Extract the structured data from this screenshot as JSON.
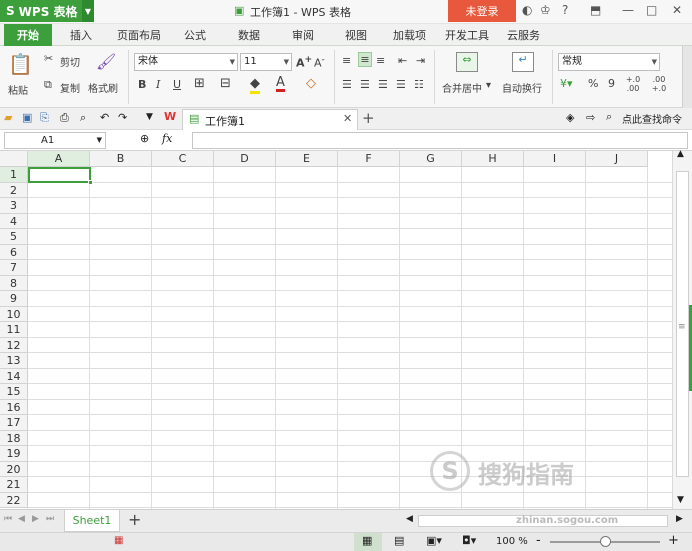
{
  "app": {
    "name": "WPS 表格",
    "doc_title": "工作簿1 - WPS 表格",
    "login": "未登录"
  },
  "menu_tabs": [
    "开始",
    "插入",
    "页面布局",
    "公式",
    "数据",
    "审阅",
    "视图",
    "加载项",
    "开发工具",
    "云服务"
  ],
  "ribbon": {
    "paste": "粘贴",
    "cut": "剪切",
    "copy": "复制",
    "format_painter": "格式刷",
    "font_name": "宋体",
    "font_size": "11",
    "bold": "B",
    "italic": "I",
    "underline": "U",
    "merge_center": "合并居中",
    "wrap_text": "自动换行",
    "number_format": "常规",
    "percent": "%",
    "thousands": "9",
    "inc_decimal": "+.0 .00",
    "dec_decimal": ".00 +.0"
  },
  "doc_tab": "工作簿1",
  "find_command": "点此查找命令",
  "name_box": "A1",
  "fx": "fx",
  "columns": [
    "A",
    "B",
    "C",
    "D",
    "E",
    "F",
    "G",
    "H",
    "I",
    "J"
  ],
  "rows": [
    "1",
    "2",
    "3",
    "4",
    "5",
    "6",
    "7",
    "8",
    "9",
    "10",
    "11",
    "12",
    "13",
    "14",
    "15",
    "16",
    "17",
    "18",
    "19",
    "20",
    "21",
    "22"
  ],
  "sheet_tab": "Sheet1",
  "add_sheet": "+",
  "zoom": "100 %",
  "zoom_minus": "-",
  "zoom_plus": "+",
  "watermark": "搜狗指南",
  "watermark_url": "zhinan.sogou.com",
  "colors": {
    "accent": "#3c9f3c",
    "login": "#e8583c"
  }
}
